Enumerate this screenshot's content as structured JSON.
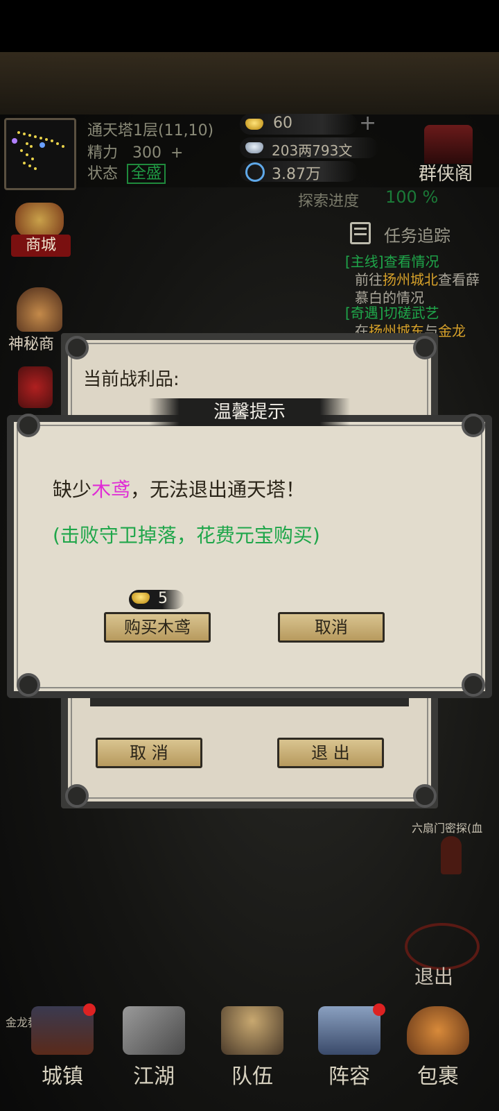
{
  "status": {
    "location": "通天塔1层(11,10)",
    "stamina_label": "精力",
    "stamina_value": "300",
    "state_label": "状态",
    "state_value": "全盛",
    "gold": "60",
    "silver": "203两793文",
    "spirit": "3.87万",
    "guild_label": "群侠阁"
  },
  "explore": {
    "label": "探索进度",
    "value": "100 %"
  },
  "left_menu": {
    "shop": "商城",
    "mystery_merchant": "神秘商"
  },
  "tasks": {
    "header": "任务追踪",
    "items": [
      {
        "tag": "[主线]",
        "title": "查看情况",
        "desc_pre": "前往",
        "desc_place": "扬州城北",
        "desc_post": "查看薛慕白的情况"
      },
      {
        "tag": "[奇遇]",
        "title": "切磋武艺",
        "desc_pre": "在",
        "desc_place": "扬州城东",
        "desc_post": "与",
        "desc_name": "金龙"
      }
    ]
  },
  "loot_dialog": {
    "header": "当前战利品:",
    "cancel": "取 消",
    "exit": "退 出"
  },
  "warning_dialog": {
    "title": "温馨提示",
    "msg_pre": "缺少",
    "msg_item": "木鸢",
    "msg_post": "，无法退出通天塔！",
    "hint": "(击败守卫掉落，花费元宝购买)",
    "cost": "5",
    "buy_button": "购买木鸢",
    "cancel_button": "取消"
  },
  "map_labels": {
    "npc": "六扇门密探(血",
    "exit": "退出",
    "faction": "金龙教"
  },
  "nav": {
    "items": [
      "城镇",
      "江湖",
      "队伍",
      "阵容",
      "包裹"
    ]
  },
  "colors": {
    "accent_green": "#1fa64a",
    "item_magenta": "#e02bd6",
    "gold_text": "#d8a22a"
  }
}
